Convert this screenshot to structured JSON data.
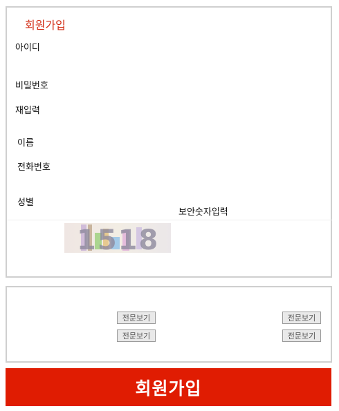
{
  "form": {
    "title": "회원가입",
    "fields": {
      "id_label": "아이디",
      "password_label": "비밀번호",
      "password_confirm_label": "재입력",
      "name_label": "이름",
      "phone_label": "전화번호",
      "gender_label": "성별"
    },
    "captcha": {
      "label": "보안숫자입력",
      "code": "1518"
    }
  },
  "terms": {
    "buttons": [
      "전문보기",
      "전문보기",
      "전문보기",
      "전문보기"
    ]
  },
  "submit": {
    "label": "회원가입"
  },
  "colors": {
    "accent": "#e01c02",
    "title": "#d22a12",
    "border": "#cfcfcf"
  }
}
